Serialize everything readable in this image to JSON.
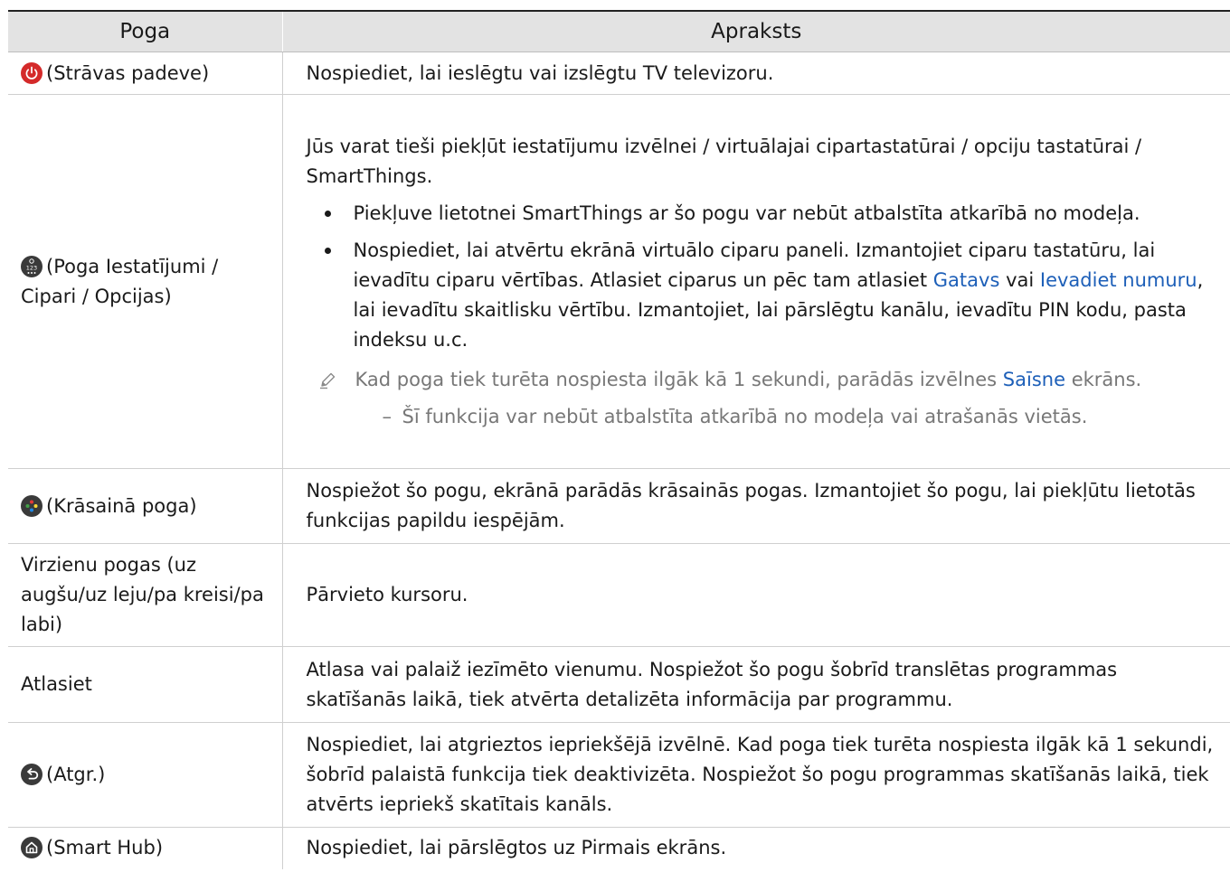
{
  "table": {
    "headers": [
      "Poga",
      "Apraksts"
    ],
    "rows": {
      "power": {
        "button": "(Strāvas padeve)",
        "desc": "Nospiediet, lai ieslēgtu vai izslēgtu TV televizoru."
      },
      "settings": {
        "button": "(Poga Iestatījumi / Cipari / Opcijas)",
        "desc_intro": "Jūs varat tieši piekļūt iestatījumu izvēlnei / virtuālajai cipartastatūrai / opciju tastatūrai / SmartThings.",
        "bullet1": "Piekļuve lietotnei SmartThings ar šo pogu var nebūt atbalstīta atkarībā no modeļa.",
        "bullet2_a": "Nospiediet, lai atvērtu ekrānā virtuālo ciparu paneli. Izmantojiet ciparu tastatūru, lai ievadītu ciparu vērtības. Atlasiet ciparus un pēc tam atlasiet ",
        "bullet2_link1": "Gatavs",
        "bullet2_b": " vai ",
        "bullet2_link2": "Ievadiet numuru",
        "bullet2_c": ", lai ievadītu skaitlisku vērtību. Izmantojiet, lai pārslēgtu kanālu, ievadītu PIN kodu, pasta indeksu u.c.",
        "note_a": "Kad poga tiek turēta nospiesta ilgāk kā 1 sekundi, parādās izvēlnes ",
        "note_link": "Saīsne",
        "note_b": " ekrāns.",
        "subnote_dash": "–",
        "subnote": "Šī funkcija var nebūt atbalstīta atkarībā no modeļa vai atrašanās vietās."
      },
      "color": {
        "button": "(Krāsainā poga)",
        "desc": "Nospiežot šo pogu, ekrānā parādās krāsainās pogas. Izmantojiet šo pogu, lai piekļūtu lietotās funkcijas papildu iespējām."
      },
      "direction": {
        "button": "Virzienu pogas (uz augšu/uz leju/pa kreisi/pa labi)",
        "desc": "Pārvieto kursoru."
      },
      "select": {
        "button": "Atlasiet",
        "desc": "Atlasa vai palaiž iezīmēto vienumu. Nospiežot šo pogu šobrīd translētas programmas skatīšanās laikā, tiek atvērta detalizēta informācija par programmu."
      },
      "back": {
        "button": "(Atgr.)",
        "desc": "Nospiediet, lai atgrieztos iepriekšējā izvēlnē. Kad poga tiek turēta nospiesta ilgāk kā 1 sekundi, šobrīd palaistā funkcija tiek deaktivizēta. Nospiežot šo pogu programmas skatīšanās laikā, tiek atvērts iepriekš skatītais kanāls."
      },
      "home": {
        "button": "(Smart Hub)",
        "desc": "Nospiediet, lai pārslēgtos uz Pirmais ekrāns."
      }
    }
  },
  "icons": {
    "power": "power-icon",
    "settings": "settings-numbers-icon",
    "color": "color-buttons-icon",
    "back": "back-icon",
    "home": "home-icon",
    "note": "pencil-icon"
  },
  "colors": {
    "link": "#1d5fb8",
    "power_icon": "#d42a2a",
    "icon_dark": "#3a3a3a",
    "header_bg": "#e3e3e3",
    "note_text": "#777777"
  }
}
